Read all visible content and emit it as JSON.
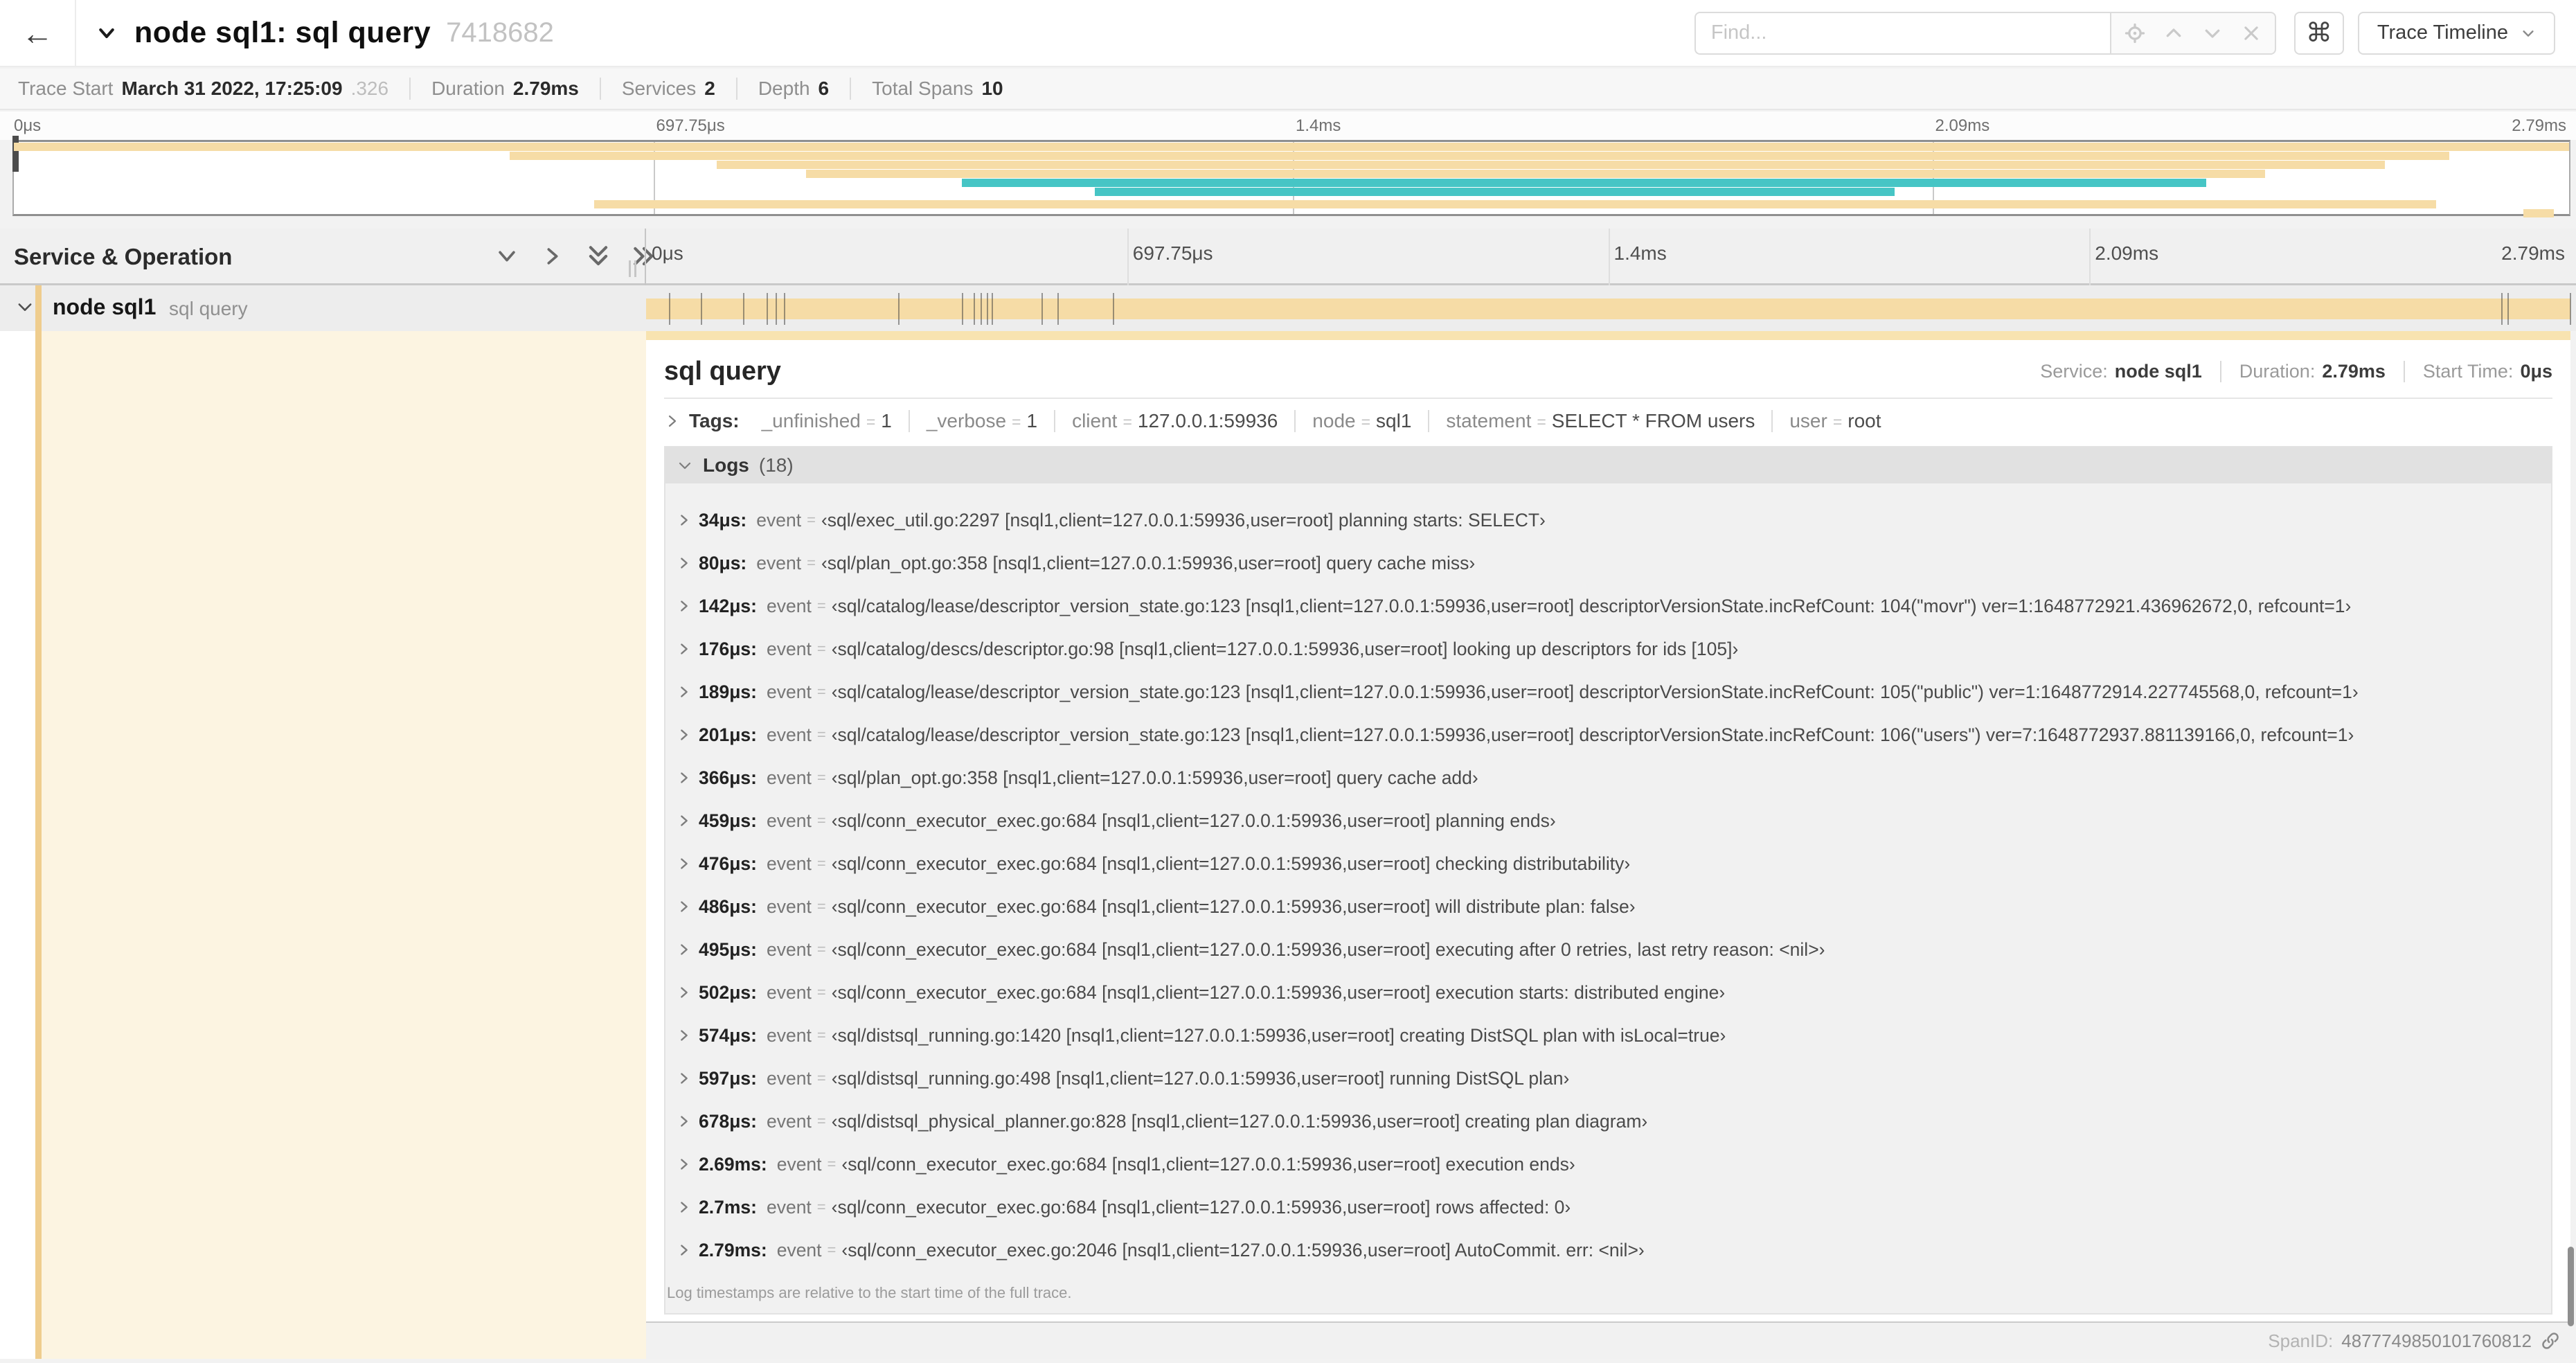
{
  "colors": {
    "span_tan": "#F6DCA6",
    "span_stripe": "#EFCD8E",
    "span_teal": "#46C5C5",
    "detail_cream": "#FCF4E1",
    "accent_strip": "#F8E3B0"
  },
  "topbar": {
    "title": "node sql1: sql query",
    "trace_id": "7418682",
    "find_placeholder": "Find...",
    "shortcut_key": "⌘",
    "view_button": "Trace Timeline"
  },
  "summary": {
    "items": [
      {
        "label": "Trace Start",
        "value": "March 31 2022, 17:25:09",
        "suffix": ".326"
      },
      {
        "label": "Duration",
        "value": "2.79ms",
        "suffix": ""
      },
      {
        "label": "Services",
        "value": "2",
        "suffix": ""
      },
      {
        "label": "Depth",
        "value": "6",
        "suffix": ""
      },
      {
        "label": "Total Spans",
        "value": "10",
        "suffix": ""
      }
    ]
  },
  "minimap": {
    "ticks": [
      {
        "label": "0μs",
        "pct": 0
      },
      {
        "label": "697.75μs",
        "pct": 25
      },
      {
        "label": "1.4ms",
        "pct": 50
      },
      {
        "label": "2.09ms",
        "pct": 75
      },
      {
        "label": "2.79ms",
        "pct": 100
      }
    ],
    "spans": [
      {
        "row": 0,
        "start": 0,
        "end": 100,
        "color": "tan"
      },
      {
        "row": 1,
        "start": 19.4,
        "end": 95.3,
        "color": "tan"
      },
      {
        "row": 2,
        "start": 27.5,
        "end": 92.8,
        "color": "tan"
      },
      {
        "row": 3,
        "start": 31.0,
        "end": 88.1,
        "color": "tan"
      },
      {
        "row": 4,
        "start": 37.1,
        "end": 85.8,
        "color": "teal"
      },
      {
        "row": 5,
        "start": 42.3,
        "end": 73.6,
        "color": "teal"
      },
      {
        "row": 6,
        "start": 22.7,
        "end": 94.8,
        "color": "tan"
      },
      {
        "row": 7,
        "start": 98.2,
        "end": 99.4,
        "color": "tan"
      }
    ]
  },
  "timeline": {
    "left_header": "Service & Operation",
    "ticks": [
      {
        "label": "0μs",
        "pct": 0
      },
      {
        "label": "697.75μs",
        "pct": 25
      },
      {
        "label": "1.4ms",
        "pct": 50
      },
      {
        "label": "2.09ms",
        "pct": 75
      },
      {
        "label": "2.79ms",
        "pct": 100
      }
    ],
    "row": {
      "service": "node sql1",
      "operation": "sql query",
      "bar_start": 0,
      "bar_end": 100,
      "log_marks_pct": [
        1.22,
        2.87,
        5.09,
        6.31,
        6.77,
        7.2,
        13.12,
        16.45,
        17.06,
        17.42,
        17.74,
        17.99,
        20.57,
        21.4,
        24.3,
        96.42,
        96.77,
        100
      ]
    }
  },
  "detail": {
    "title": "sql query",
    "meta": [
      {
        "label": "Service:",
        "value": "node sql1"
      },
      {
        "label": "Duration:",
        "value": "2.79ms"
      },
      {
        "label": "Start Time:",
        "value": "0μs"
      }
    ],
    "tags_label": "Tags:",
    "tags": [
      {
        "key": "_unfinished",
        "value": "1"
      },
      {
        "key": "_verbose",
        "value": "1"
      },
      {
        "key": "client",
        "value": "127.0.0.1:59936"
      },
      {
        "key": "node",
        "value": "sql1"
      },
      {
        "key": "statement",
        "value": "SELECT * FROM users"
      },
      {
        "key": "user",
        "value": "root"
      }
    ],
    "logs_label": "Logs",
    "logs_count": "(18)",
    "log_key": "event",
    "logs": [
      {
        "time": "34μs:",
        "value": "‹sql/exec_util.go:2297 [nsql1,client=127.0.0.1:59936,user=root] planning starts: SELECT›"
      },
      {
        "time": "80μs:",
        "value": "‹sql/plan_opt.go:358 [nsql1,client=127.0.0.1:59936,user=root] query cache miss›"
      },
      {
        "time": "142μs:",
        "value": "‹sql/catalog/lease/descriptor_version_state.go:123 [nsql1,client=127.0.0.1:59936,user=root] descriptorVersionState.incRefCount: 104(\"movr\") ver=1:1648772921.436962672,0, refcount=1›"
      },
      {
        "time": "176μs:",
        "value": "‹sql/catalog/descs/descriptor.go:98 [nsql1,client=127.0.0.1:59936,user=root] looking up descriptors for ids [105]›"
      },
      {
        "time": "189μs:",
        "value": "‹sql/catalog/lease/descriptor_version_state.go:123 [nsql1,client=127.0.0.1:59936,user=root] descriptorVersionState.incRefCount: 105(\"public\") ver=1:1648772914.227745568,0, refcount=1›"
      },
      {
        "time": "201μs:",
        "value": "‹sql/catalog/lease/descriptor_version_state.go:123 [nsql1,client=127.0.0.1:59936,user=root] descriptorVersionState.incRefCount: 106(\"users\") ver=7:1648772937.881139166,0, refcount=1›"
      },
      {
        "time": "366μs:",
        "value": "‹sql/plan_opt.go:358 [nsql1,client=127.0.0.1:59936,user=root] query cache add›"
      },
      {
        "time": "459μs:",
        "value": "‹sql/conn_executor_exec.go:684 [nsql1,client=127.0.0.1:59936,user=root] planning ends›"
      },
      {
        "time": "476μs:",
        "value": "‹sql/conn_executor_exec.go:684 [nsql1,client=127.0.0.1:59936,user=root] checking distributability›"
      },
      {
        "time": "486μs:",
        "value": "‹sql/conn_executor_exec.go:684 [nsql1,client=127.0.0.1:59936,user=root] will distribute plan: false›"
      },
      {
        "time": "495μs:",
        "value": "‹sql/conn_executor_exec.go:684 [nsql1,client=127.0.0.1:59936,user=root] executing after 0 retries, last retry reason: <nil>›"
      },
      {
        "time": "502μs:",
        "value": "‹sql/conn_executor_exec.go:684 [nsql1,client=127.0.0.1:59936,user=root] execution starts: distributed engine›"
      },
      {
        "time": "574μs:",
        "value": "‹sql/distsql_running.go:1420 [nsql1,client=127.0.0.1:59936,user=root] creating DistSQL plan with isLocal=true›"
      },
      {
        "time": "597μs:",
        "value": "‹sql/distsql_running.go:498 [nsql1,client=127.0.0.1:59936,user=root] running DistSQL plan›"
      },
      {
        "time": "678μs:",
        "value": "‹sql/distsql_physical_planner.go:828 [nsql1,client=127.0.0.1:59936,user=root] creating plan diagram›"
      },
      {
        "time": "2.69ms:",
        "value": "‹sql/conn_executor_exec.go:684 [nsql1,client=127.0.0.1:59936,user=root] execution ends›"
      },
      {
        "time": "2.7ms:",
        "value": "‹sql/conn_executor_exec.go:684 [nsql1,client=127.0.0.1:59936,user=root] rows affected: 0›"
      },
      {
        "time": "2.79ms:",
        "value": "‹sql/conn_executor_exec.go:2046 [nsql1,client=127.0.0.1:59936,user=root] AutoCommit. err: <nil>›"
      }
    ],
    "logs_note": "Log timestamps are relative to the start time of the full trace.",
    "span_id_label": "SpanID:",
    "span_id": "4877749850101760812"
  }
}
